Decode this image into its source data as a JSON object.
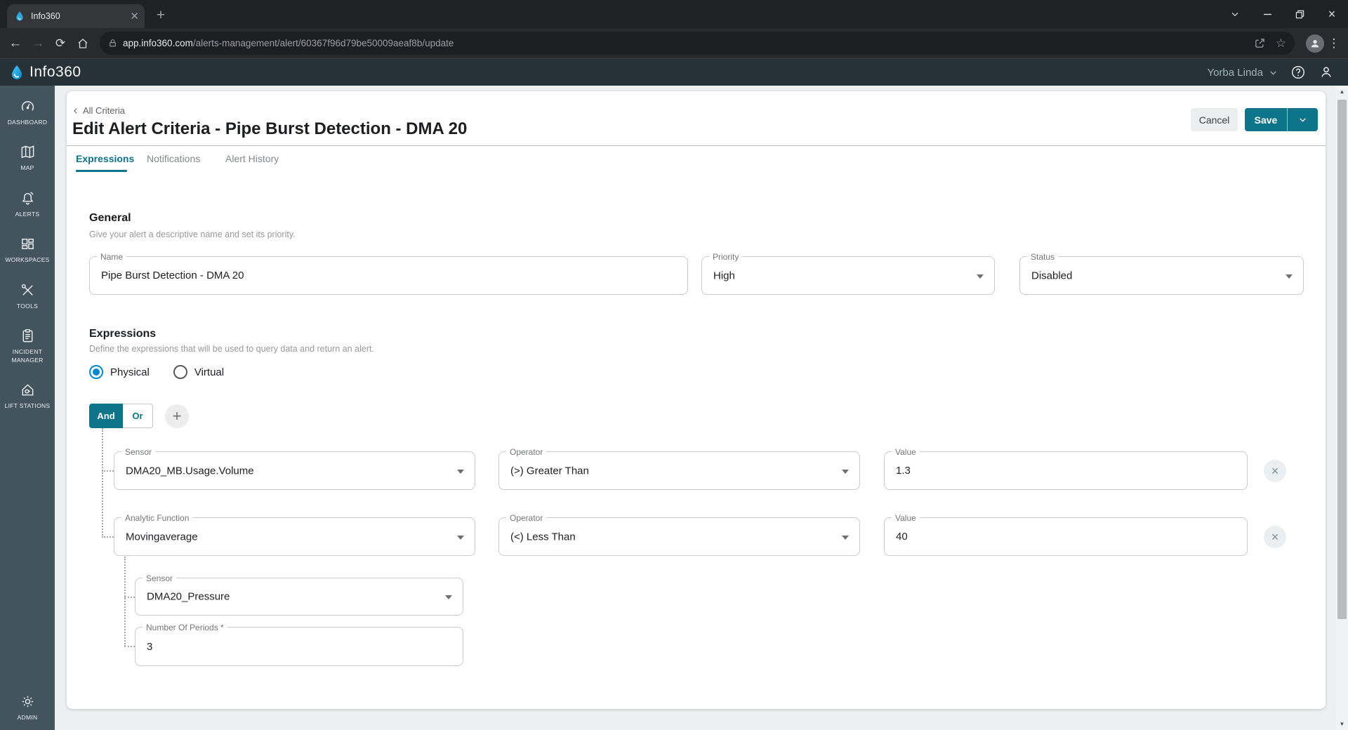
{
  "colors": {
    "accent": "#0e7489",
    "radio_selected": "#0288d1",
    "header_bg": "#263238",
    "sidebar_bg": "#44545e"
  },
  "browser": {
    "tab_title": "Info360",
    "url_host": "app.info360.com",
    "url_path": "/alerts-management/alert/60367f96d79be50009aeaf8b/update"
  },
  "app_header": {
    "brand": "Info360",
    "location": "Yorba Linda"
  },
  "sidebar": {
    "items": [
      {
        "label": "DASHBOARD",
        "icon": "gauge-icon"
      },
      {
        "label": "MAP",
        "icon": "map-icon"
      },
      {
        "label": "ALERTS",
        "icon": "bell-icon"
      },
      {
        "label": "WORKSPACES",
        "icon": "windows-icon"
      },
      {
        "label": "TOOLS",
        "icon": "tools-icon"
      },
      {
        "label": "INCIDENT MANAGER",
        "icon": "clipboard-icon"
      },
      {
        "label": "LIFT STATIONS",
        "icon": "pump-house-icon"
      }
    ],
    "admin": {
      "label": "ADMIN",
      "icon": "gear-icon"
    }
  },
  "page": {
    "breadcrumb": "All Criteria",
    "title": "Edit Alert Criteria - Pipe Burst Detection - DMA 20",
    "cancel_label": "Cancel",
    "save_label": "Save",
    "tabs": [
      "Expressions",
      "Notifications",
      "Alert History"
    ],
    "active_tab": "Expressions"
  },
  "general": {
    "heading": "General",
    "subtitle": "Give your alert a descriptive name and set its priority.",
    "name": {
      "label": "Name",
      "value": "Pipe Burst Detection - DMA 20"
    },
    "priority": {
      "label": "Priority",
      "value": "High"
    },
    "status": {
      "label": "Status",
      "value": "Disabled"
    }
  },
  "expressions": {
    "heading": "Expressions",
    "subtitle": "Define the expressions that will be used to query data and return an alert.",
    "type_options": {
      "physical": "Physical",
      "virtual": "Virtual",
      "selected": "Physical"
    },
    "logic": {
      "and": "And",
      "or": "Or",
      "selected": "And"
    },
    "row1": {
      "sensor": {
        "label": "Sensor",
        "value": "DMA20_MB.Usage.Volume"
      },
      "operator": {
        "label": "Operator",
        "value": "(>) Greater Than"
      },
      "value": {
        "label": "Value",
        "value": "1.3"
      }
    },
    "row2": {
      "function": {
        "label": "Analytic Function",
        "value": "Movingaverage"
      },
      "operator": {
        "label": "Operator",
        "value": "(<) Less Than"
      },
      "value": {
        "label": "Value",
        "value": "40"
      }
    },
    "row3": {
      "sensor": {
        "label": "Sensor",
        "value": "DMA20_Pressure"
      },
      "periods": {
        "label": "Number Of Periods *",
        "value": "3"
      }
    }
  }
}
